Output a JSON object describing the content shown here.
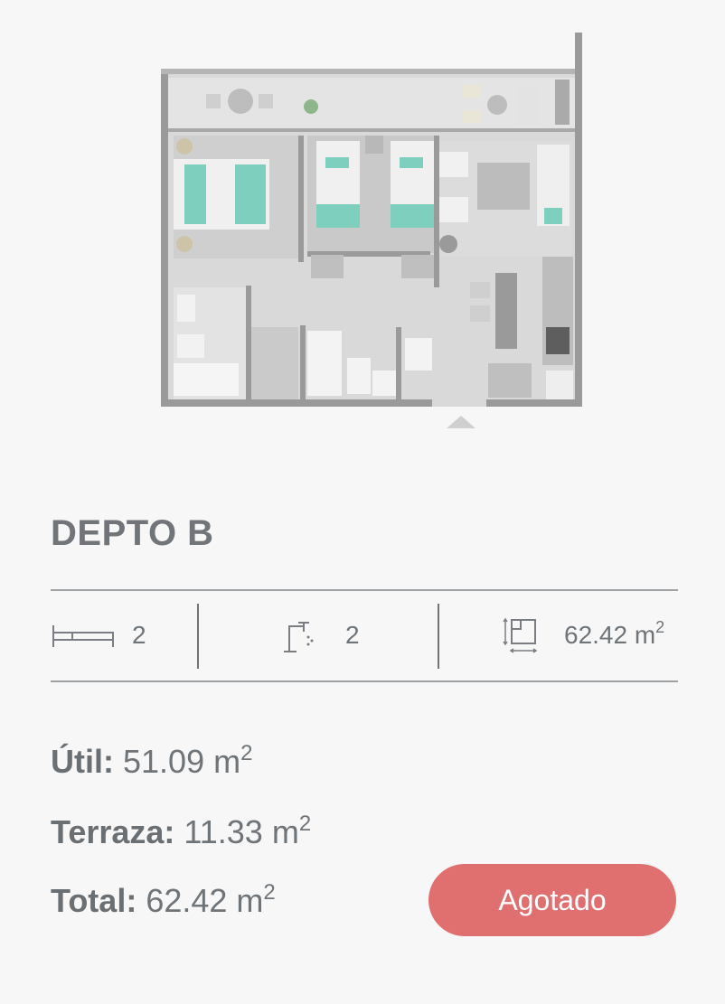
{
  "unit": {
    "name": "DEPTO B",
    "bedrooms": "2",
    "bathrooms": "2",
    "area_total": "62.42 m",
    "area_unit_sup": "2"
  },
  "details": {
    "util_label": "Útil:",
    "util_value": "51.09 m",
    "terraza_label": "Terraza:",
    "terraza_value": "11.33 m",
    "total_label": "Total:",
    "total_value": "62.42 m",
    "sup": "2"
  },
  "status_button": "Agotado",
  "icons": {
    "bed": "bed-icon",
    "bath": "faucet-icon",
    "area": "floor-area-icon",
    "plan": "floor-plan-image"
  },
  "colors": {
    "button": "#e06f6f",
    "accent_teal": "#7fcfbf"
  }
}
